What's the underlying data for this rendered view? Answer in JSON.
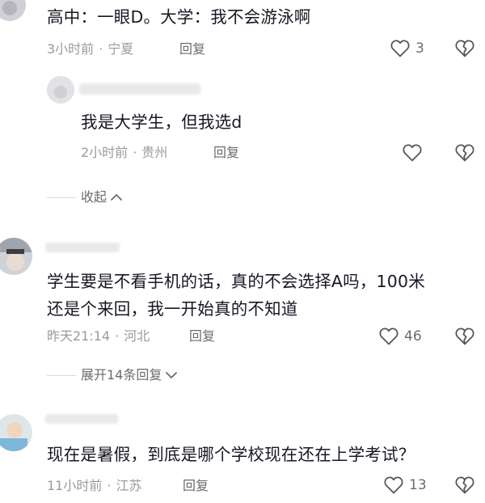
{
  "comments": [
    {
      "text": "高中：一眼D。大学：我不会游泳啊",
      "time": "3小时前",
      "location": "宁夏",
      "reply_label": "回复",
      "likes": "3"
    },
    {
      "text": "我是大学生，但我选d",
      "time": "2小时前",
      "location": "贵州",
      "reply_label": "回复",
      "likes": ""
    },
    {
      "text_line1": "学生要是不看手机的话，真的不会选择A吗，100米",
      "text_line2": "还是个来回，我一开始真的不知道",
      "time": "昨天21:14",
      "location": "河北",
      "reply_label": "回复",
      "likes": "46"
    },
    {
      "text": "现在是暑假，到底是哪个学校现在还在上学考试？",
      "time": "11小时前",
      "location": "江苏",
      "reply_label": "回复",
      "likes": "13"
    }
  ],
  "collapse_label": "收起",
  "expand_label": "展开14条回复",
  "separator": "·",
  "icons": {
    "like": "heart-outline-icon",
    "dislike": "broken-heart-icon",
    "collapse": "chevron-up-icon",
    "expand": "chevron-down-icon"
  }
}
